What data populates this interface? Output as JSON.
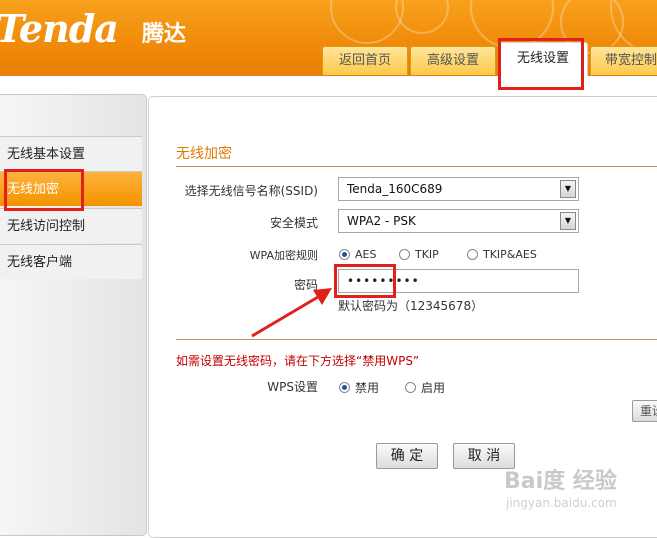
{
  "header": {
    "logo_text": "Tenda",
    "logo_cn": "腾达",
    "tabs": [
      {
        "label": "返回首页"
      },
      {
        "label": "高级设置"
      },
      {
        "label": "无线设置"
      },
      {
        "label": "带宽控制"
      }
    ]
  },
  "sidebar": {
    "items": [
      {
        "label": "无线基本设置"
      },
      {
        "label": "无线加密"
      },
      {
        "label": "无线访问控制"
      },
      {
        "label": "无线客户端"
      }
    ]
  },
  "main": {
    "section_title": "无线加密",
    "ssid_label": "选择无线信号名称(SSID)",
    "ssid_value": "Tenda_160C689",
    "security_label": "安全模式",
    "security_value": "WPA2 - PSK",
    "wpa_rule_label": "WPA加密规则",
    "wpa_options": [
      "AES",
      "TKIP",
      "TKIP&AES"
    ],
    "wpa_selected": "AES",
    "password_label": "密码",
    "password_value": "•••••••••",
    "password_hint": "默认密码为（12345678）",
    "wps_warning": "如需设置无线密码，请在下方选择“禁用WPS”",
    "wps_label": "WPS设置",
    "wps_options": [
      "禁用",
      "启用"
    ],
    "wps_selected": "禁用",
    "reset_label": "重设",
    "ok_label": "确 定",
    "cancel_label": "取 消"
  },
  "watermark": {
    "text": "Bai度 经验",
    "url": "jingyan.baidu.com"
  },
  "colors": {
    "header_orange": "#f08c0a",
    "active_orange": "#f39300",
    "section_title": "#e07b00",
    "warning_red": "#c40000",
    "annotation_red": "#e0201a"
  }
}
